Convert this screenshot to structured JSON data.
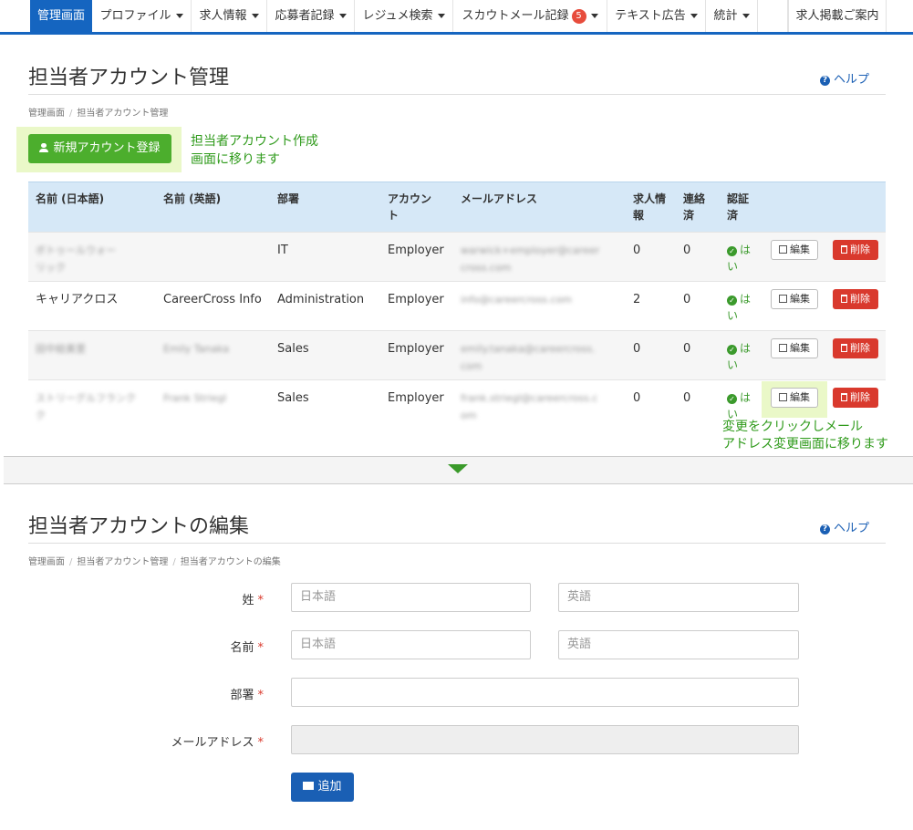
{
  "nav": {
    "items": [
      {
        "label": "管理画面",
        "dropdown": false
      },
      {
        "label": "プロファイル",
        "dropdown": true
      },
      {
        "label": "求人情報",
        "dropdown": true
      },
      {
        "label": "応募者記録",
        "dropdown": true
      },
      {
        "label": "レジュメ検索",
        "dropdown": true
      },
      {
        "label": "スカウトメール記録",
        "dropdown": true,
        "badge": "5"
      },
      {
        "label": "テキスト広告",
        "dropdown": true
      },
      {
        "label": "統計",
        "dropdown": true
      },
      {
        "label": "求人掲載ご案内",
        "dropdown": false
      }
    ]
  },
  "list_section": {
    "title": "担当者アカウント管理",
    "help": "ヘルプ",
    "breadcrumb": [
      "管理画面",
      "担当者アカウント管理"
    ],
    "new_button": "新規アカウント登録",
    "annotation_new": [
      "担当者アカウント作成",
      "画面に移ります"
    ],
    "annotation_edit": [
      "変更をクリックしメール",
      "アドレス変更画面に移ります"
    ],
    "table": {
      "headers": [
        "名前 (日本語)",
        "名前 (英語)",
        "部署",
        "アカウント",
        "メールアドレス",
        "求人情報",
        "連絡済",
        "認証済"
      ],
      "header_lines": {
        "account": [
          "アカウン",
          "ト"
        ],
        "jobs": [
          "求人情",
          "報"
        ],
        "contacted": [
          "連絡",
          "済"
        ],
        "verified": [
          "認証",
          "済"
        ]
      },
      "rows": [
        {
          "name_ja": [
            "ボトゥールウォー",
            "リック"
          ],
          "name_en": "",
          "dept": "IT",
          "account": "Employer",
          "email": [
            "warwick+employer@career",
            "cross.com"
          ],
          "jobs": "0",
          "contacted": "0",
          "verified": [
            "は",
            "い"
          ],
          "blurred": true
        },
        {
          "name_ja": [
            "キャリアクロス"
          ],
          "name_en": "CareerCross Info",
          "dept": "Administration",
          "account": "Employer",
          "email": [
            "info@careercross.com"
          ],
          "jobs": "2",
          "contacted": "0",
          "verified": [
            "は",
            "い"
          ],
          "blurred": false
        },
        {
          "name_ja": [
            "田中絵美里"
          ],
          "name_en": "Emily Tanaka",
          "dept": "Sales",
          "account": "Employer",
          "email": [
            "emily.tanaka@careercross.",
            "com"
          ],
          "jobs": "0",
          "contacted": "0",
          "verified": [
            "は",
            "い"
          ],
          "blurred": true
        },
        {
          "name_ja": [
            "ストリーグルフランク",
            "ク"
          ],
          "name_en": "Frank Striegl",
          "dept": "Sales",
          "account": "Employer",
          "email": [
            "frank.striegl@careercross.c",
            "om"
          ],
          "jobs": "0",
          "contacted": "0",
          "verified": [
            "は",
            "い"
          ],
          "blurred": true
        }
      ],
      "edit_label": "編集",
      "delete_label": "削除"
    }
  },
  "edit_section": {
    "title": "担当者アカウントの編集",
    "help": "ヘルプ",
    "breadcrumb": [
      "管理画面",
      "担当者アカウント管理",
      "担当者アカウントの編集"
    ],
    "fields": {
      "last_name_label": "姓",
      "first_name_label": "名前",
      "dept_label": "部署",
      "email_label": "メールアドレス",
      "placeholder_ja": "日本語",
      "placeholder_en": "英語",
      "required_mark": "*"
    },
    "submit": "追加"
  },
  "colors": {
    "brand": "#1565c0",
    "green": "#4cae2d",
    "danger": "#d9392d",
    "annotation": "#2e9a1a",
    "highlight": "#eaf8c8"
  }
}
